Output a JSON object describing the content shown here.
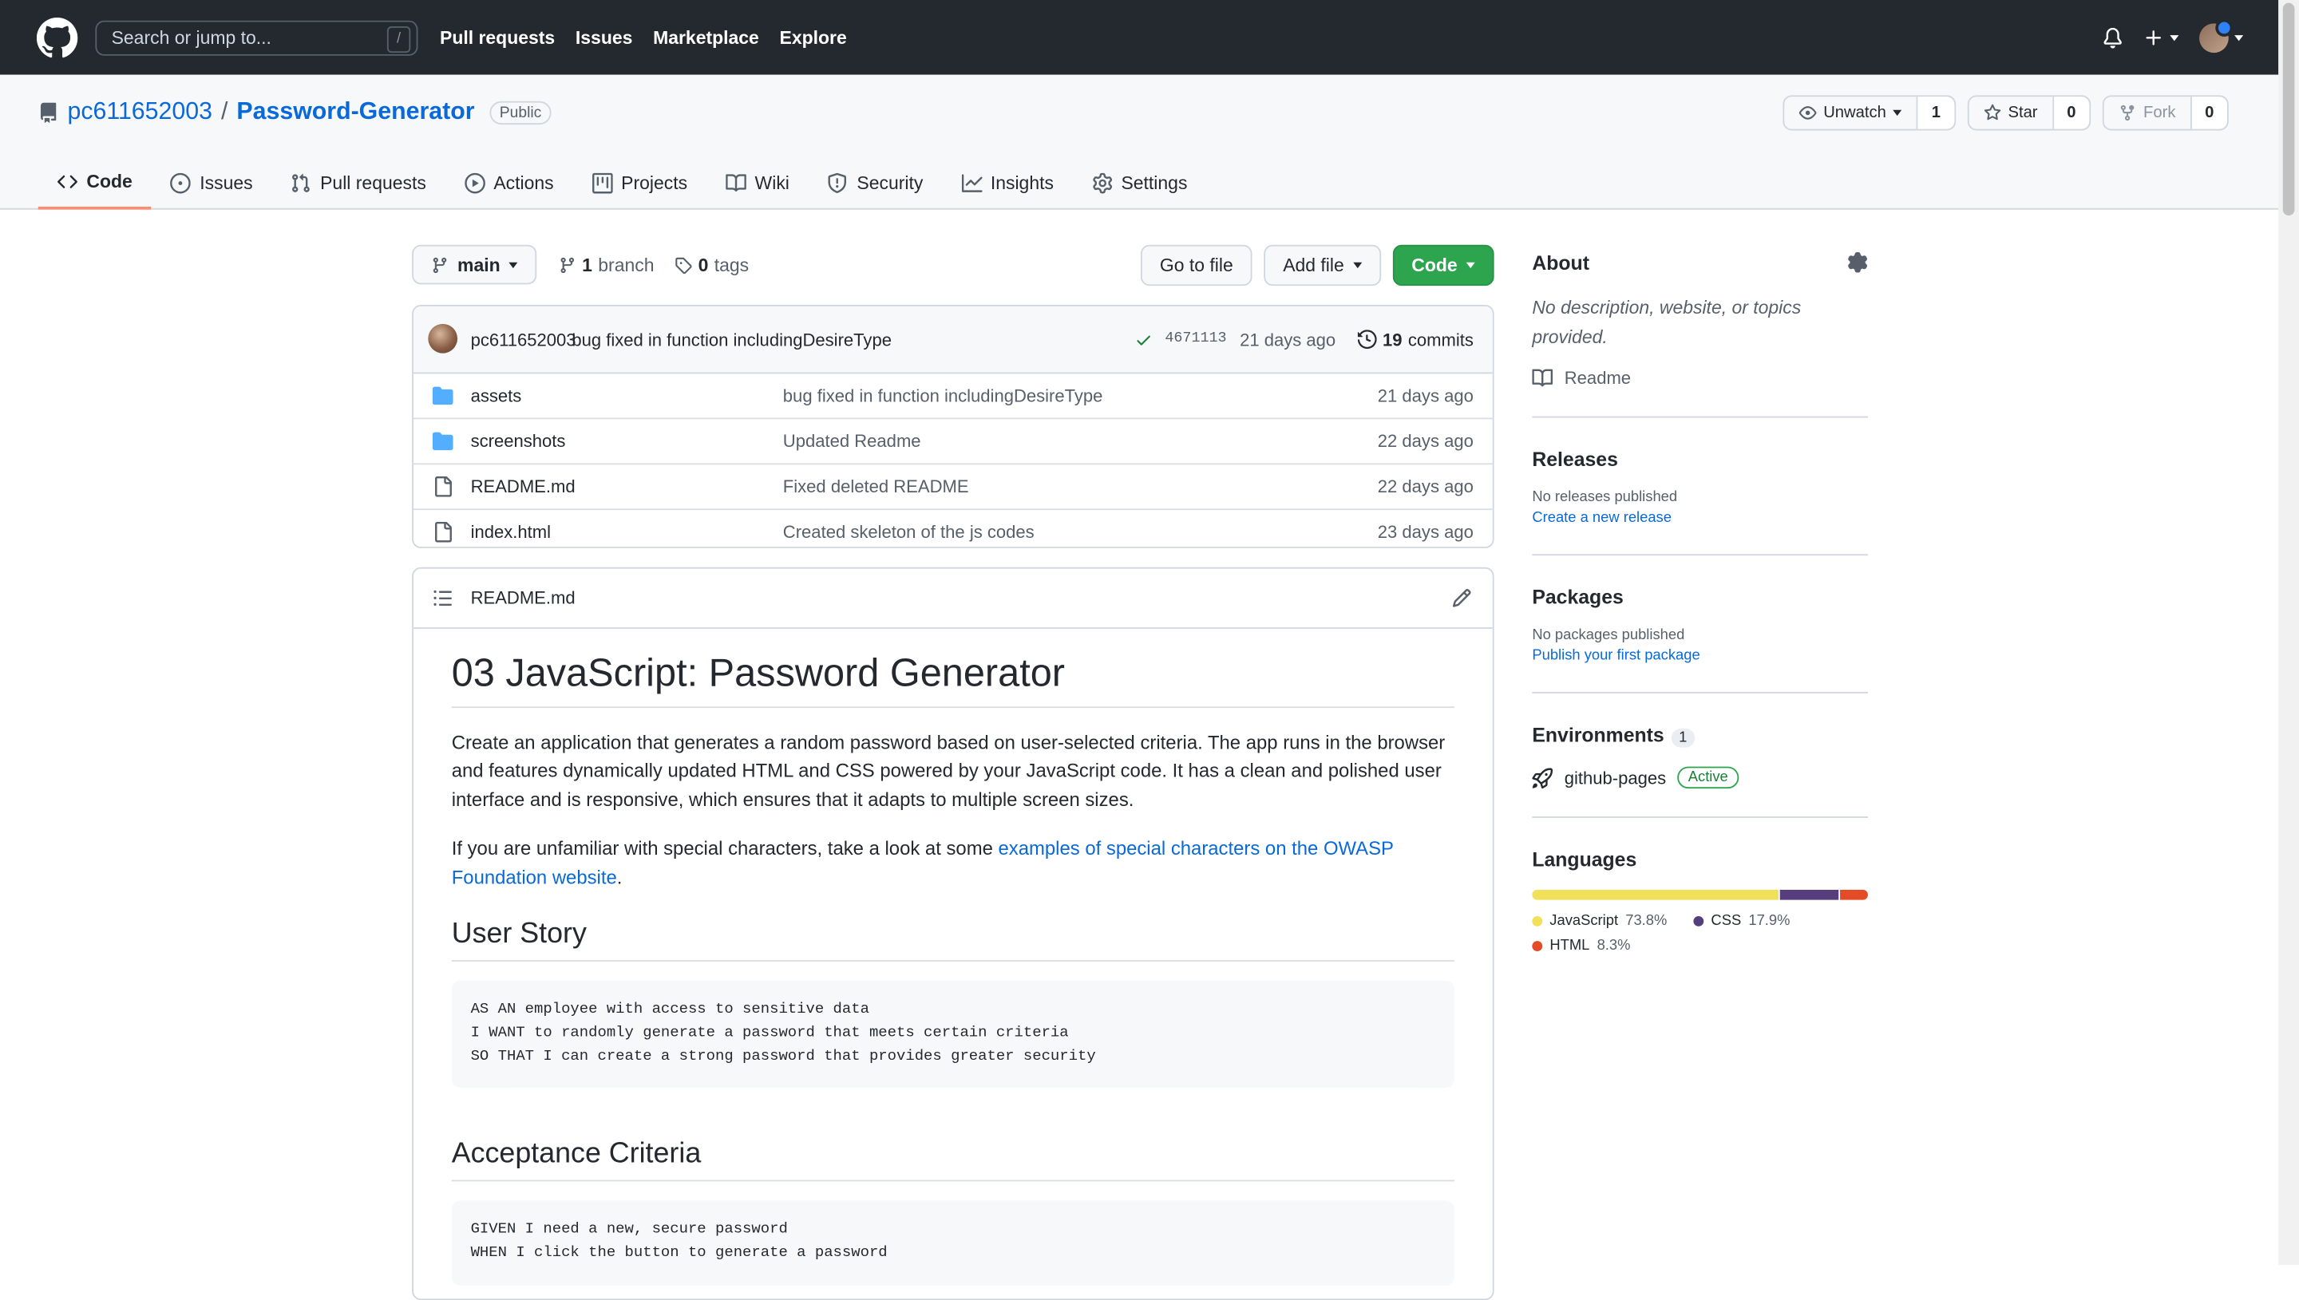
{
  "header": {
    "search_placeholder": "Search or jump to...",
    "search_shortcut": "/",
    "nav": [
      "Pull requests",
      "Issues",
      "Marketplace",
      "Explore"
    ]
  },
  "repo": {
    "owner": "pc611652003",
    "separator": "/",
    "name": "Password-Generator",
    "visibility": "Public",
    "watch_label": "Unwatch",
    "watch_count": "1",
    "star_label": "Star",
    "star_count": "0",
    "fork_label": "Fork",
    "fork_count": "0"
  },
  "tabs": [
    {
      "label": "Code",
      "icon": "code-icon"
    },
    {
      "label": "Issues",
      "icon": "issue-icon"
    },
    {
      "label": "Pull requests",
      "icon": "pull-request-icon"
    },
    {
      "label": "Actions",
      "icon": "play-icon"
    },
    {
      "label": "Projects",
      "icon": "project-icon"
    },
    {
      "label": "Wiki",
      "icon": "book-icon"
    },
    {
      "label": "Security",
      "icon": "shield-icon"
    },
    {
      "label": "Insights",
      "icon": "graph-icon"
    },
    {
      "label": "Settings",
      "icon": "gear-icon"
    }
  ],
  "branch": {
    "name": "main",
    "branch_count": "1",
    "branch_label": "branch",
    "tag_count": "0",
    "tag_label": "tags",
    "goto_file": "Go to file",
    "add_file": "Add file",
    "code": "Code"
  },
  "commit": {
    "author": "pc611652003",
    "message": "bug fixed in function includingDesireType",
    "sha": "4671113",
    "age": "21 days ago",
    "count": "19",
    "count_label": "commits"
  },
  "files": [
    {
      "type": "folder",
      "name": "assets",
      "message": "bug fixed in function includingDesireType",
      "age": "21 days ago"
    },
    {
      "type": "folder",
      "name": "screenshots",
      "message": "Updated Readme",
      "age": "22 days ago"
    },
    {
      "type": "file",
      "name": "README.md",
      "message": "Fixed deleted README",
      "age": "22 days ago"
    },
    {
      "type": "file",
      "name": "index.html",
      "message": "Created skeleton of the js codes",
      "age": "23 days ago"
    }
  ],
  "readme": {
    "filename": "README.md",
    "title": "03 JavaScript: Password Generator",
    "para1": "Create an application that generates a random password based on user-selected criteria. The app runs in the browser and features dynamically updated HTML and CSS powered by your JavaScript code. It has a clean and polished user interface and is responsive, which ensures that it adapts to multiple screen sizes.",
    "para2_before": "If you are unfamiliar with special characters, take a look at some ",
    "para2_link": "examples of special characters on the OWASP Foundation website",
    "para2_after": ".",
    "h_user_story": "User Story",
    "user_story": "AS AN employee with access to sensitive data\nI WANT to randomly generate a password that meets certain criteria\nSO THAT I can create a strong password that provides greater security",
    "h_acceptance": "Acceptance Criteria",
    "acceptance": "GIVEN I need a new, secure password\nWHEN I click the button to generate a password"
  },
  "sidebar": {
    "about_title": "About",
    "about_desc": "No description, website, or topics provided.",
    "readme_link": "Readme",
    "releases_title": "Releases",
    "releases_none": "No releases published",
    "releases_link": "Create a new release",
    "packages_title": "Packages",
    "packages_none": "No packages published",
    "packages_link": "Publish your first package",
    "environments_title": "Environments",
    "environments_count": "1",
    "env_name": "github-pages",
    "env_status": "Active",
    "languages_title": "Languages",
    "languages": [
      {
        "name": "JavaScript",
        "percent": "73.8%",
        "share": 73.8,
        "color": "#f1e05a"
      },
      {
        "name": "CSS",
        "percent": "17.9%",
        "share": 17.9,
        "color": "#563d7c"
      },
      {
        "name": "HTML",
        "percent": "8.3%",
        "share": 8.3,
        "color": "#e34c26"
      }
    ]
  },
  "colors": {
    "header_bg": "#24292f",
    "link": "#0969da",
    "green_button": "#2da44e",
    "active_tab_underline": "#fd8c73"
  }
}
